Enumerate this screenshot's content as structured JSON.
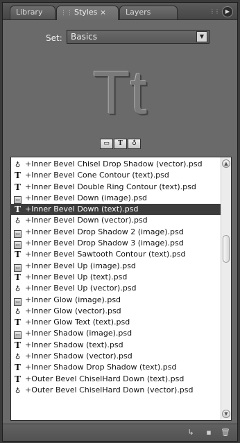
{
  "tabs": [
    {
      "label": "Library",
      "active": false
    },
    {
      "label": "Styles",
      "active": true,
      "close": "×"
    },
    {
      "label": "Layers",
      "active": false
    }
  ],
  "set_label": "Set:",
  "set_value": "Basics",
  "preview_text": "Tt",
  "filters": [
    "image-filter-icon",
    "text-filter-icon",
    "vector-filter-icon"
  ],
  "filter_glyphs": {
    "image": "▭",
    "text": "T",
    "vector": "♁"
  },
  "styles": [
    {
      "icon": "vector",
      "label": "+Inner Bevel Chisel Drop Shadow (vector).psd"
    },
    {
      "icon": "text",
      "label": "+Inner Bevel Cone Contour (text).psd"
    },
    {
      "icon": "text",
      "label": "+Inner Bevel Double Ring Contour (text).psd"
    },
    {
      "icon": "image",
      "label": "+Inner Bevel Down (image).psd"
    },
    {
      "icon": "text",
      "label": "+Inner Bevel Down (text).psd",
      "selected": true
    },
    {
      "icon": "vector",
      "label": "+Inner Bevel Down (vector).psd"
    },
    {
      "icon": "image",
      "label": "+Inner Bevel Drop Shadow 2 (image).psd"
    },
    {
      "icon": "image",
      "label": "+Inner Bevel Drop Shadow 3 (image).psd"
    },
    {
      "icon": "text",
      "label": "+Inner Bevel Sawtooth Contour (text).psd"
    },
    {
      "icon": "image",
      "label": "+Inner Bevel Up (image).psd"
    },
    {
      "icon": "text",
      "label": "+Inner Bevel Up (text).psd"
    },
    {
      "icon": "vector",
      "label": "+Inner Bevel Up (vector).psd"
    },
    {
      "icon": "image",
      "label": "+Inner Glow (image).psd"
    },
    {
      "icon": "vector",
      "label": "+Inner Glow (vector).psd"
    },
    {
      "icon": "text",
      "label": "+Inner Glow Text (text).psd"
    },
    {
      "icon": "image",
      "label": "+Inner Shadow (image).psd"
    },
    {
      "icon": "text",
      "label": "+Inner Shadow (text).psd"
    },
    {
      "icon": "vector",
      "label": "+Inner Shadow (vector).psd"
    },
    {
      "icon": "text",
      "label": "+Inner Shadow Drop Shadow (text).psd"
    },
    {
      "icon": "text",
      "label": "+Outer Bevel ChiselHard Down (text).psd"
    },
    {
      "icon": "vector",
      "label": "+Outer Bevel ChiselHard Down (vector).psd"
    }
  ],
  "colors": {
    "panel": "#6a6a6a",
    "selected_row": "#3c3c3c",
    "list_bg": "#ffffff"
  }
}
